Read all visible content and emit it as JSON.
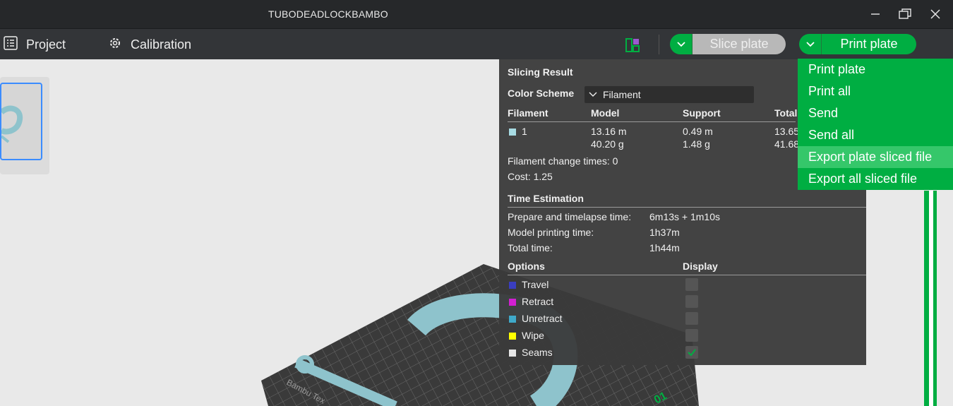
{
  "window": {
    "title": "TUBODEADLOCKBAMBO"
  },
  "toolbar": {
    "project": "Project",
    "calibration": "Calibration",
    "slice_plate": "Slice plate",
    "print_plate": "Print plate"
  },
  "menu": {
    "items": [
      "Print plate",
      "Print all",
      "Send",
      "Send all",
      "Export plate sliced file",
      "Export all sliced file"
    ]
  },
  "result": {
    "title": "Slicing Result",
    "color_scheme_label": "Color Scheme",
    "color_scheme_value": "Filament",
    "col_filament": "Filament",
    "col_model": "Model",
    "col_support": "Support",
    "col_total": "Total",
    "filament_id": "1",
    "model_len": "13.16 m",
    "model_wt": "40.20 g",
    "support_len": "0.49 m",
    "support_wt": "1.48 g",
    "total_len": "13.65 m",
    "total_wt": "41.68 g",
    "change_times": "Filament change times:  0",
    "cost": "Cost:  1.25",
    "time_title": "Time Estimation",
    "prepare_label": "Prepare and timelapse time:",
    "prepare_value": "6m13s + 1m10s",
    "model_time_label": "Model printing time:",
    "model_time_value": "1h37m",
    "total_time_label": "Total time:",
    "total_time_value": "1h44m",
    "options_title": "Options",
    "display_title": "Display",
    "options": [
      {
        "label": "Travel",
        "color": "#3a3ec0",
        "checked": false
      },
      {
        "label": "Retract",
        "color": "#d21fd2",
        "checked": false
      },
      {
        "label": "Unretract",
        "color": "#3fa9c9",
        "checked": false
      },
      {
        "label": "Wipe",
        "color": "#ffff00",
        "checked": false
      },
      {
        "label": "Seams",
        "color": "#e6e6e6",
        "checked": true
      }
    ]
  },
  "colors": {
    "accent": "#00ae42",
    "filament_swatch": "#a7dbe3",
    "model": "#8ec3cc"
  }
}
